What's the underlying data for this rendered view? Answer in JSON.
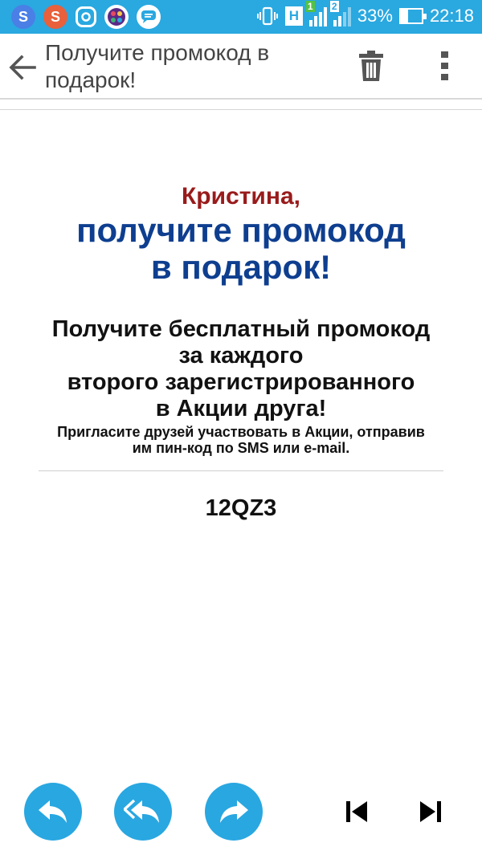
{
  "status_bar": {
    "battery_percent": "33%",
    "battery_level": 0.33,
    "time": "22:18",
    "network_type": "H",
    "sim1_label": "1",
    "sim2_label": "2",
    "app_icons": [
      "s-app-icon",
      "s-app-icon",
      "instagram-icon",
      "paint-app-icon",
      "messages-icon"
    ],
    "color": "#2aa8e0"
  },
  "toolbar": {
    "title": "Получите промокод в подарок!",
    "back_icon": "arrow-left-icon",
    "trash_icon": "trash-icon",
    "more_icon": "more-vert-icon"
  },
  "email": {
    "greeting": "Кристина,",
    "headline_line1": "получите промокод",
    "headline_line2": "в подарок!",
    "offer_lines": [
      "Получите бесплатный промокод",
      "за каждого",
      "второго зарегистрированного",
      "в Акции друга!"
    ],
    "invite_line1": "Пригласите друзей участвовать в Акции, отправив",
    "invite_line2": "им пин-код по SMS или e-mail.",
    "promo_code": "12QZ3",
    "greeting_color": "#991b1b",
    "headline_color": "#0e3e8f"
  },
  "bottom_bar": {
    "reply_icon": "reply-icon",
    "reply_all_icon": "reply-all-icon",
    "forward_icon": "forward-icon",
    "first_icon": "skip-previous-icon",
    "last_icon": "skip-next-icon",
    "button_color": "#29a7e1"
  }
}
